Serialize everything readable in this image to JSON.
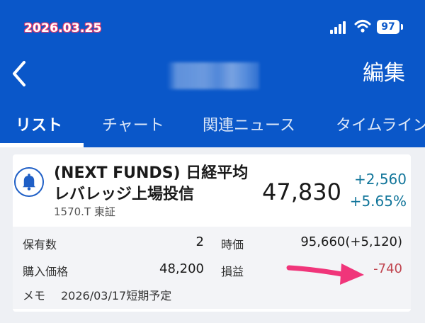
{
  "status_bar": {
    "date_label": "2026.03.25",
    "battery_level": "97"
  },
  "nav": {
    "title": "",
    "edit_label": "編集"
  },
  "tabs": [
    {
      "label": "リスト",
      "active": true
    },
    {
      "label": "チャート",
      "active": false
    },
    {
      "label": "関連ニュース",
      "active": false
    },
    {
      "label": "タイムライン",
      "active": false
    }
  ],
  "fund": {
    "name_line1": "(NEXT FUNDS) 日経平均",
    "name_line2": "レバレッジ上場投信",
    "code": "1570.T 東証",
    "price": "47,830",
    "change_abs": "+2,560",
    "change_pct": "+5.65%"
  },
  "holding": {
    "quantity_label": "保有数",
    "quantity_value": "2",
    "market_value_label": "時価",
    "market_value": "95,660(+5,120)",
    "purchase_price_label": "購入価格",
    "purchase_price": "48,200",
    "pl_label": "損益",
    "pl_value": "-740",
    "memo_label": "メモ",
    "memo_value": "2026/03/17短期予定"
  },
  "colors": {
    "header_blue": "#0a57c9",
    "positive": "#11759a",
    "negative": "#c0444f",
    "arrow_pink": "#f0357a"
  },
  "icons": {
    "back": "chevron-left-icon",
    "bell": "bell-icon",
    "signal": "cellular-signal-icon",
    "wifi": "wifi-icon",
    "battery": "battery-icon",
    "annotation_arrow": "arrow-right-icon"
  }
}
